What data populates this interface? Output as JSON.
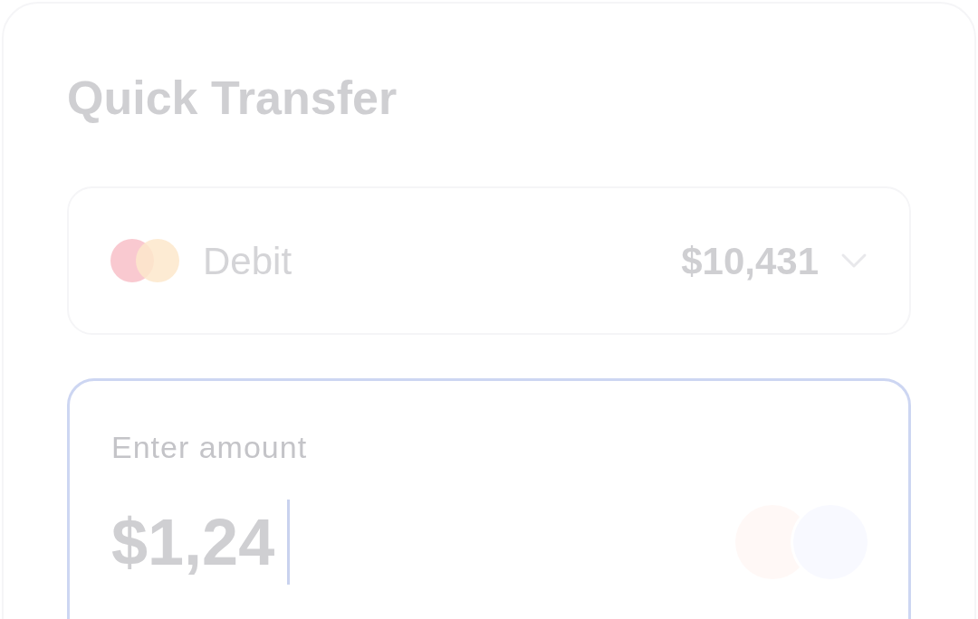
{
  "title": "Quick Transfer",
  "account": {
    "name": "Debit",
    "balance": "$10,431",
    "expanded": false
  },
  "amount_field": {
    "label": "Enter amount",
    "value": "$1,24",
    "focused": true
  }
}
